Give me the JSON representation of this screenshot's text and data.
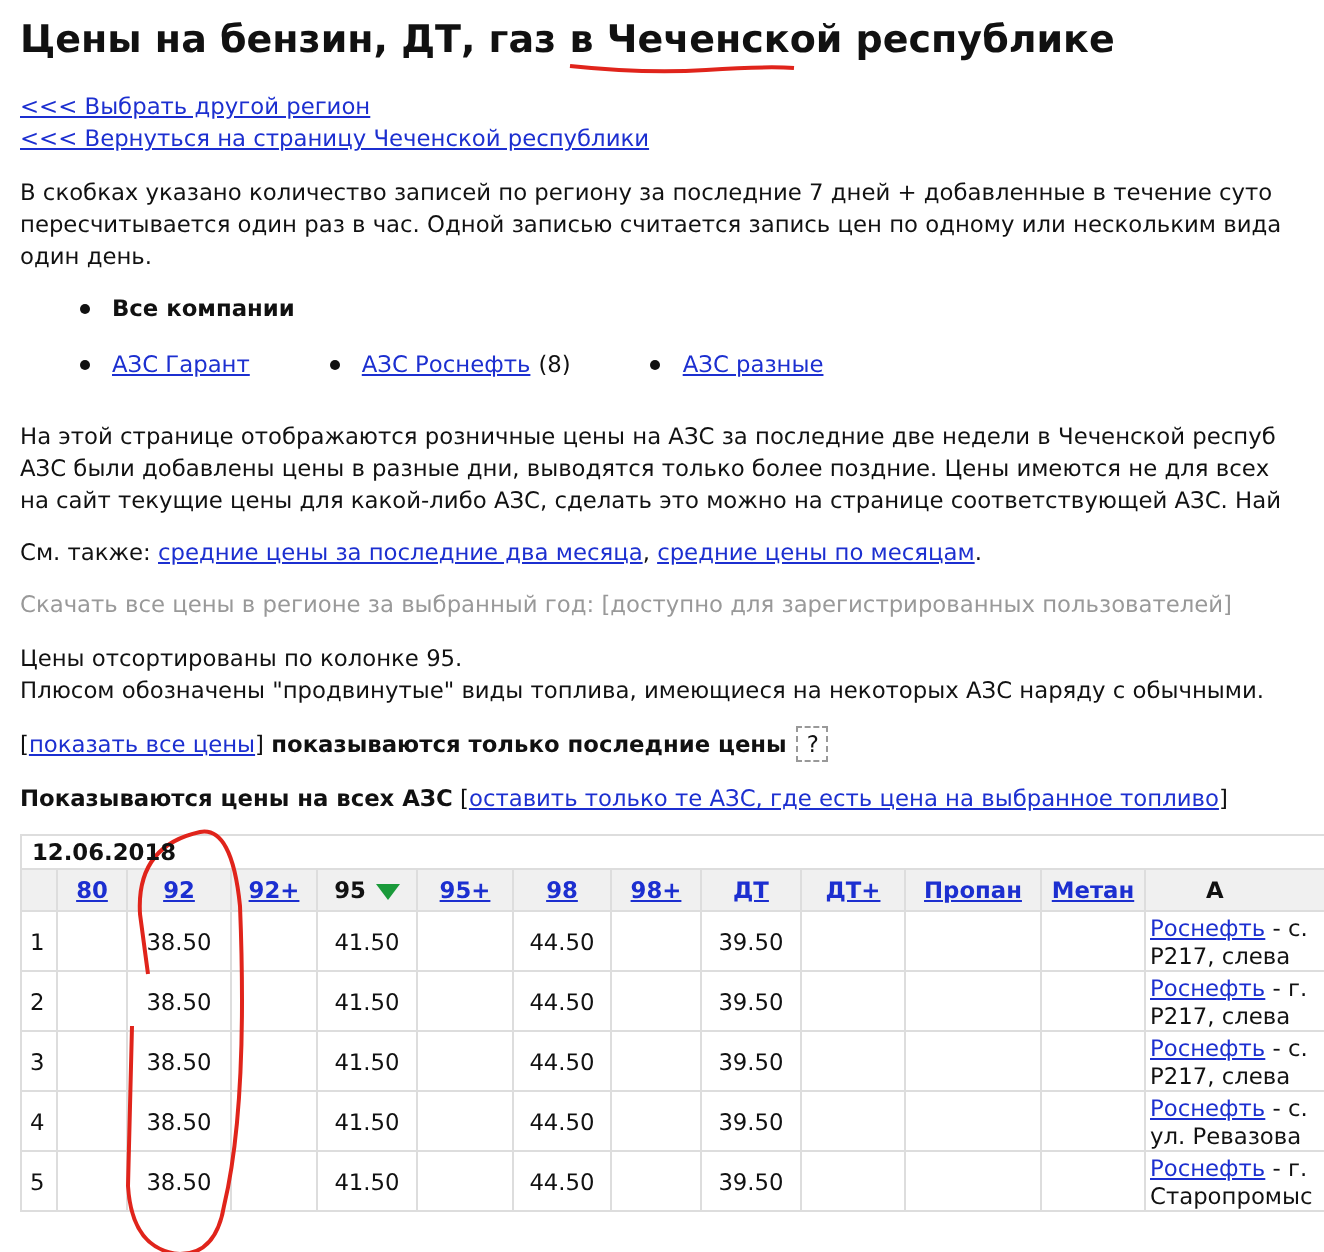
{
  "title": {
    "before": "Цены на бензин, ДТ, газ в ",
    "region": "Чеченской",
    "after": " республике"
  },
  "nav_links": [
    "<<< Выбрать другой регион",
    "<<< Вернуться на страницу Чеченской республики"
  ],
  "intro": [
    "В скобках указано количество записей по региону за последние 7 дней + добавленные в течение суто",
    "пересчитывается один раз в час. Одной записью считается запись цен по одному или нескольким вида",
    "один день."
  ],
  "all_companies": {
    "label": "Все компании",
    "selected": true
  },
  "companies": [
    {
      "label": "АЗС Гарант",
      "selected": false
    },
    {
      "label": "АЗС Роснефть",
      "count": "(8)",
      "selected": false
    },
    {
      "label": "АЗС разные",
      "selected": false
    }
  ],
  "description": [
    "На этой странице отображаются розничные цены на АЗС за последние две недели в Чеченской респуб",
    "АЗС были добавлены цены в разные дни, выводятся только более поздние. Цены имеются не для всех",
    "на сайт текущие цены для какой-либо АЗС, сделать это можно на странице соответствующей АЗС. Най"
  ],
  "see_also": {
    "label": "См. также:",
    "links": [
      "средние цены за последние два месяца",
      "средние цены по месяцам"
    ],
    "separator": ",",
    "end": "."
  },
  "download": {
    "text": "Скачать все цены в регионе за выбранный год: [доступно для зарегистрированных пользователей]",
    "disabled": true
  },
  "sort_note": [
    "Цены отсортированы по колонке 95.",
    "Плюсом обозначены \"продвинутые\" виды топлива, имеющиеся на некоторых АЗС наряду с обычными."
  ],
  "mode_toggle": {
    "open": "[",
    "link": "показать все цены",
    "close": "]",
    "status": "показываются только последние цены",
    "help": "?"
  },
  "station_filter": {
    "status": "Показываются цены на всех АЗС",
    "open": "[",
    "link": "оставить только те АЗС, где есть цена на выбранное топливо",
    "close": "]"
  },
  "table": {
    "date": "12.06.2018",
    "columns": [
      {
        "label": "80",
        "sorted": false
      },
      {
        "label": "92",
        "sorted": false
      },
      {
        "label": "92+",
        "sorted": false
      },
      {
        "label": "95",
        "sorted": true
      },
      {
        "label": "95+",
        "sorted": false
      },
      {
        "label": "98",
        "sorted": false
      },
      {
        "label": "98+",
        "sorted": false
      },
      {
        "label": "ДТ",
        "sorted": false
      },
      {
        "label": "ДТ+",
        "sorted": false
      },
      {
        "label": "Пропан",
        "sorted": false
      },
      {
        "label": "Метан",
        "sorted": false
      }
    ],
    "station_column": "А",
    "rows": [
      {
        "number": "1",
        "prices": [
          {
            "kind": "blank"
          },
          {
            "kind": "price",
            "value": "38.50"
          },
          {
            "kind": "blank"
          },
          {
            "kind": "price",
            "value": "41.50"
          },
          {
            "kind": "blank"
          },
          {
            "kind": "price",
            "value": "44.50"
          },
          {
            "kind": "blank"
          },
          {
            "kind": "price",
            "value": "39.50"
          },
          {
            "kind": "blank"
          },
          {
            "kind": "blank"
          },
          {
            "kind": "blank"
          }
        ],
        "brand": "Роснефть",
        "place": " - с.",
        "address": "Р217, слева"
      },
      {
        "number": "2",
        "prices": [
          {
            "kind": "blank"
          },
          {
            "kind": "price",
            "value": "38.50"
          },
          {
            "kind": "blank"
          },
          {
            "kind": "price",
            "value": "41.50"
          },
          {
            "kind": "blank"
          },
          {
            "kind": "price",
            "value": "44.50"
          },
          {
            "kind": "blank"
          },
          {
            "kind": "price",
            "value": "39.50"
          },
          {
            "kind": "blank"
          },
          {
            "kind": "blank"
          },
          {
            "kind": "blank"
          }
        ],
        "brand": "Роснефть",
        "place": " - г.",
        "address": "Р217, слева"
      },
      {
        "number": "3",
        "prices": [
          {
            "kind": "blank"
          },
          {
            "kind": "price",
            "value": "38.50"
          },
          {
            "kind": "blank"
          },
          {
            "kind": "price",
            "value": "41.50"
          },
          {
            "kind": "blank"
          },
          {
            "kind": "price",
            "value": "44.50"
          },
          {
            "kind": "blank"
          },
          {
            "kind": "price",
            "value": "39.50"
          },
          {
            "kind": "blank"
          },
          {
            "kind": "blank"
          },
          {
            "kind": "blank"
          }
        ],
        "brand": "Роснефть",
        "place": " - с.",
        "address": "Р217, слева"
      },
      {
        "number": "4",
        "prices": [
          {
            "kind": "blank"
          },
          {
            "kind": "price",
            "value": "38.50"
          },
          {
            "kind": "blank"
          },
          {
            "kind": "price",
            "value": "41.50"
          },
          {
            "kind": "blank"
          },
          {
            "kind": "price",
            "value": "44.50"
          },
          {
            "kind": "blank"
          },
          {
            "kind": "price",
            "value": "39.50"
          },
          {
            "kind": "blank"
          },
          {
            "kind": "blank"
          },
          {
            "kind": "blank"
          }
        ],
        "brand": "Роснефть",
        "place": " - с.",
        "address": "ул. Ревазова"
      },
      {
        "number": "5",
        "prices": [
          {
            "kind": "blank"
          },
          {
            "kind": "price",
            "value": "38.50"
          },
          {
            "kind": "blank"
          },
          {
            "kind": "price",
            "value": "41.50"
          },
          {
            "kind": "blank"
          },
          {
            "kind": "price",
            "value": "44.50"
          },
          {
            "kind": "blank"
          },
          {
            "kind": "price",
            "value": "39.50"
          },
          {
            "kind": "blank"
          },
          {
            "kind": "blank"
          },
          {
            "kind": "blank"
          }
        ],
        "brand": "Роснефть",
        "place": " - г.",
        "address": "Старопромыс"
      }
    ]
  }
}
